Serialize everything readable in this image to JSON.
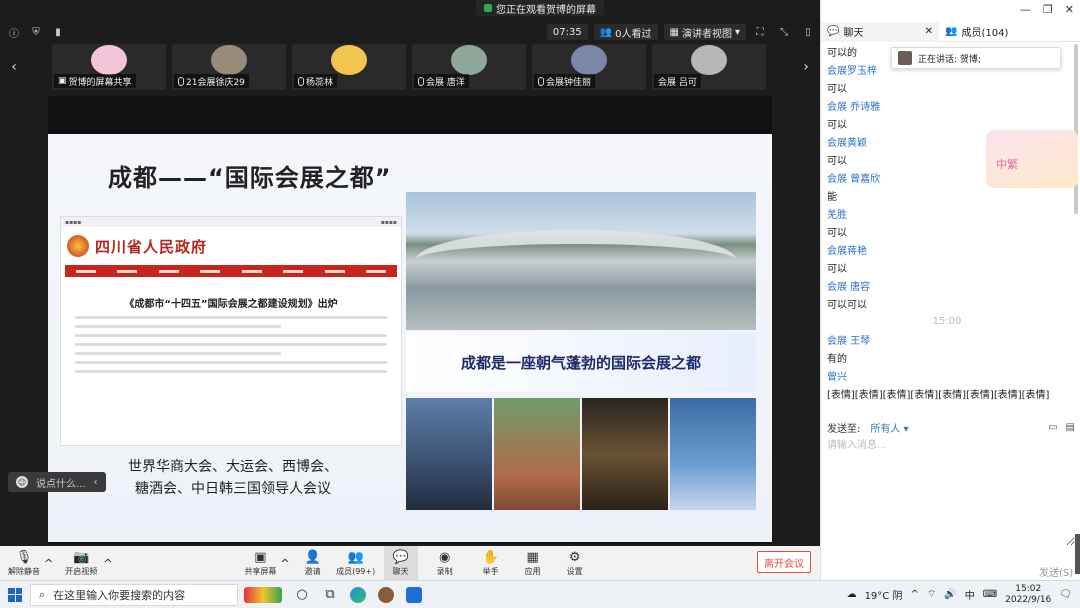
{
  "share_banner": "您正在观看贺博的屏幕",
  "topbar": {
    "time": "07:35",
    "viewers": "0人看过",
    "view_mode": "演讲者视图"
  },
  "participants": [
    {
      "name": "贺博的屏幕共享",
      "avatar_color": "#f2c6d8"
    },
    {
      "name": "21会展徐庆29",
      "avatar_color": "#9a8a7a"
    },
    {
      "name": "杨蕊林",
      "avatar_color": "#f3c54f"
    },
    {
      "name": "会展 唐洋",
      "avatar_color": "#8fa69b"
    },
    {
      "name": "会展钟佳丽",
      "avatar_color": "#7b86a8"
    },
    {
      "name": "会展 吕可",
      "avatar_color": "#b7b7b7"
    }
  ],
  "slide": {
    "title": "成都——“国际会展之都”",
    "gov_site_name": "四川省人民政府",
    "gov_article_title": "《成都市“十四五”国际会展之都建设规划》出炉",
    "tagline": "成都是一座朝气蓬勃的国际会展之都",
    "events_line1": "世界华商大会、大运会、西博会、",
    "events_line2": "糖酒会、中日韩三国领导人会议"
  },
  "say_bubble": "说点什么...",
  "toolbar": {
    "mute": "解除静音",
    "video": "开启视频",
    "share": "共享屏幕",
    "invite": "邀请",
    "members": "成员(99+)",
    "chat": "聊天",
    "record": "录制",
    "raise_hand": "举手",
    "apps": "应用",
    "settings": "设置",
    "leave": "离开会议"
  },
  "side_panel": {
    "chat_tab": "聊天",
    "members_tab": "成员(104)",
    "speaking": "正在讲话: 贺博;",
    "sticker_text": "中繁",
    "messages": [
      {
        "kind": "text",
        "text": "可以的"
      },
      {
        "kind": "name",
        "text": "会展罗玉梓"
      },
      {
        "kind": "text",
        "text": "可以"
      },
      {
        "kind": "name",
        "text": "会展 乔诗雅"
      },
      {
        "kind": "text",
        "text": "可以"
      },
      {
        "kind": "name",
        "text": "会展黄颖"
      },
      {
        "kind": "text",
        "text": "可以"
      },
      {
        "kind": "name",
        "text": "会展  曾嘉欣"
      },
      {
        "kind": "text",
        "text": "能"
      },
      {
        "kind": "name",
        "text": "羌胜"
      },
      {
        "kind": "text",
        "text": "可以"
      },
      {
        "kind": "name",
        "text": "会展蒋艳"
      },
      {
        "kind": "text",
        "text": "可以"
      },
      {
        "kind": "name",
        "text": "会展  唐容"
      },
      {
        "kind": "text",
        "text": "可以可以"
      },
      {
        "kind": "time",
        "text": "15:00"
      },
      {
        "kind": "name",
        "text": "会展 王琴"
      },
      {
        "kind": "text",
        "text": "有的"
      },
      {
        "kind": "name",
        "text": "曾兴"
      },
      {
        "kind": "text",
        "text": "[表情][表情][表情][表情][表情][表情][表情][表情]"
      }
    ],
    "send_to_label": "发送至:",
    "send_to_value": "所有人",
    "input_placeholder": "请输入消息...",
    "send_button": "发送(S)"
  },
  "taskbar": {
    "search_placeholder": "在这里输入你要搜索的内容",
    "weather": "19°C 阴",
    "ime": "中",
    "time": "15:02",
    "date": "2022/9/16"
  }
}
